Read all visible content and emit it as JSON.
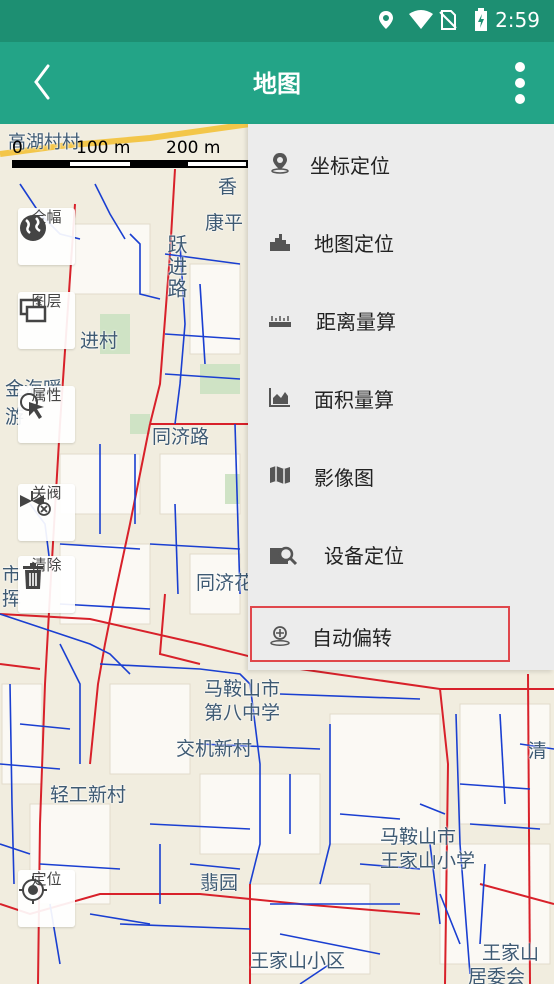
{
  "status_bar": {
    "time": "2:59",
    "icons": [
      "location-icon",
      "wifi-icon",
      "no-sim-icon",
      "battery-charging-icon"
    ]
  },
  "app_bar": {
    "title": "地图",
    "back_icon": "chevron-left-icon",
    "more_icon": "more-vert-icon"
  },
  "map": {
    "scale": {
      "labels": [
        "0",
        "100 m",
        "200 m"
      ]
    },
    "labels": [
      "高湖村村",
      "香",
      "康平",
      "跃进路",
      "进村",
      "金海暖",
      "游",
      "同济路",
      "同济花",
      "市",
      "挥",
      "马鞍山市",
      "第八中学",
      "交机新村",
      "轻工新村",
      "马鞍山市",
      "王家山小学",
      "翡园",
      "王家山小区",
      "王家山",
      "居委会",
      "清"
    ]
  },
  "tools": [
    {
      "label": "全幅",
      "icon": "globe-icon"
    },
    {
      "label": "图层",
      "icon": "layers-icon"
    },
    {
      "label": "属性",
      "icon": "pointer-click-icon"
    },
    {
      "label": "关阀",
      "icon": "valve-icon"
    },
    {
      "label": "清除",
      "icon": "trash-icon"
    },
    {
      "label": "定位",
      "icon": "crosshair-icon"
    }
  ],
  "menu": {
    "items": [
      {
        "label": "坐标定位",
        "icon": "pin-icon"
      },
      {
        "label": "地图定位",
        "icon": "city-icon"
      },
      {
        "label": "距离量算",
        "icon": "ruler-icon"
      },
      {
        "label": "面积量算",
        "icon": "area-chart-icon"
      },
      {
        "label": "影像图",
        "icon": "map-image-icon"
      },
      {
        "label": "设备定位",
        "icon": "device-search-icon"
      },
      {
        "label": "自动偏转",
        "icon": "auto-rotate-icon"
      }
    ],
    "selected_index": 6
  },
  "colors": {
    "status_bar": "#1d8f72",
    "app_bar": "#23a487",
    "highlight": "#e0474c",
    "pipe": "#1a3fd1",
    "road": "#d8212a"
  }
}
